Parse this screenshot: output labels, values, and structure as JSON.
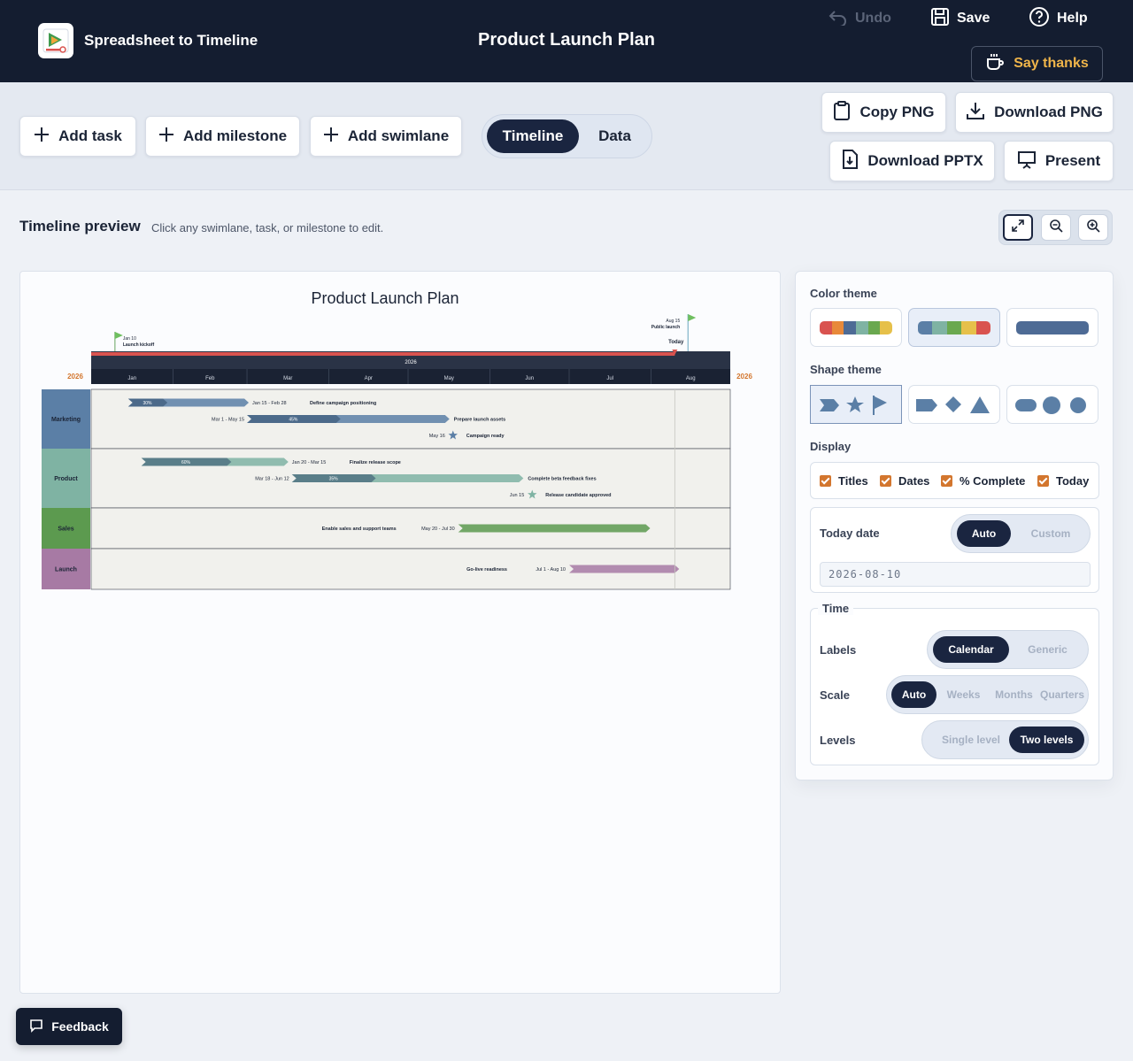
{
  "app": {
    "name": "Spreadsheet to Timeline",
    "document_title": "Product Launch Plan"
  },
  "header_actions": {
    "undo": "Undo",
    "save": "Save",
    "help": "Help",
    "say_thanks": "Say thanks"
  },
  "toolbar": {
    "add_task": "Add task",
    "add_milestone": "Add milestone",
    "add_swimlane": "Add swimlane",
    "view_tabs": [
      {
        "label": "Timeline",
        "active": true
      },
      {
        "label": "Data",
        "active": false
      }
    ],
    "copy_png": "Copy PNG",
    "download_png": "Download PNG",
    "download_pptx": "Download PPTX",
    "present": "Present"
  },
  "preview": {
    "title": "Timeline preview",
    "hint": "Click any swimlane, task, or milestone to edit.",
    "zoom_buttons": [
      "expand-icon",
      "zoom-out-icon",
      "zoom-in-icon"
    ]
  },
  "timeline": {
    "title": "Product Launch Plan",
    "year_left": "2026",
    "year_right": "2026",
    "year_band": "2026",
    "months": [
      "Jan",
      "Feb",
      "Mar",
      "Apr",
      "May",
      "Jun",
      "Jul",
      "Aug"
    ],
    "today_label": "Today",
    "top_milestones": [
      {
        "date": "Jan 10",
        "label": "Launch kickoff"
      },
      {
        "date": "Aug 15",
        "label": "Public launch"
      }
    ],
    "swimlanes": [
      {
        "name": "Marketing",
        "color": "#5b7fa6",
        "items": [
          {
            "type": "task",
            "title": "Define campaign positioning",
            "dates": "Jan 15 - Feb 28",
            "start": "Jan 15",
            "end": "Feb 28",
            "percent": "30%",
            "complete": 0.3,
            "color": "#5b7fa6"
          },
          {
            "type": "task",
            "title": "Prepare launch assets",
            "dates": "Mar 1 - May 15",
            "start": "Mar 1",
            "end": "May 15",
            "percent": "45%",
            "complete": 0.45,
            "color": "#5b7fa6"
          },
          {
            "type": "milestone",
            "title": "Campaign ready",
            "dates": "May 16",
            "date": "May 16",
            "color": "#5b7fa6"
          }
        ]
      },
      {
        "name": "Product",
        "color": "#7fb3a3",
        "items": [
          {
            "type": "task",
            "title": "Finalize release scope",
            "dates": "Jan 20 - Mar 15",
            "start": "Jan 20",
            "end": "Mar 15",
            "percent": "60%",
            "complete": 0.6,
            "color": "#7fb3a3"
          },
          {
            "type": "task",
            "title": "Complete beta feedback fixes",
            "dates": "Mar 18 - Jun 12",
            "start": "Mar 18",
            "end": "Jun 12",
            "percent": "35%",
            "complete": 0.35,
            "color": "#7fb3a3"
          },
          {
            "type": "milestone",
            "title": "Release candidate approved",
            "dates": "Jun 15",
            "date": "Jun 15",
            "color": "#7fb3a3"
          }
        ]
      },
      {
        "name": "Sales",
        "color": "#5c9a4f",
        "items": [
          {
            "type": "task",
            "title": "Enable sales and support teams",
            "dates": "May 20 - Jul 30",
            "start": "May 20",
            "end": "Jul 30",
            "color": "#5c9a4f"
          }
        ]
      },
      {
        "name": "Launch",
        "color": "#a77aa4",
        "items": [
          {
            "type": "task",
            "title": "Go-live readiness",
            "dates": "Jul 1 - Aug 10",
            "start": "Jul 1",
            "end": "Aug 10",
            "color": "#a77aa4"
          }
        ]
      }
    ]
  },
  "settings": {
    "color_theme_label": "Color theme",
    "color_themes": [
      {
        "colors": [
          "#d9534f",
          "#e8893a",
          "#4e6b95",
          "#7fb3a3",
          "#6aa84f",
          "#e6c04a"
        ],
        "selected": false
      },
      {
        "colors": [
          "#5b7fa6",
          "#7fb3a3",
          "#6aa84f",
          "#e6c04a",
          "#d9534f"
        ],
        "selected": true
      },
      {
        "colors": [
          "#4e6b95"
        ],
        "selected": false
      }
    ],
    "shape_theme_label": "Shape theme",
    "display_label": "Display",
    "display_options": [
      {
        "label": "Titles",
        "checked": true
      },
      {
        "label": "Dates",
        "checked": true
      },
      {
        "label": "% Complete",
        "checked": true
      },
      {
        "label": "Today",
        "checked": true
      }
    ],
    "today_date_label": "Today date",
    "today_modes": [
      {
        "label": "Auto",
        "active": true
      },
      {
        "label": "Custom",
        "active": false
      }
    ],
    "today_value": "2026-08-10",
    "time_label": "Time",
    "labels_label": "Labels",
    "labels_modes": [
      {
        "label": "Calendar",
        "active": true
      },
      {
        "label": "Generic",
        "active": false
      }
    ],
    "scale_label": "Scale",
    "scale_modes": [
      {
        "label": "Auto",
        "active": true
      },
      {
        "label": "Weeks",
        "active": false
      },
      {
        "label": "Months",
        "active": false
      },
      {
        "label": "Quarters",
        "active": false
      }
    ],
    "levels_label": "Levels",
    "levels_modes": [
      {
        "label": "Single level",
        "active": false
      },
      {
        "label": "Two levels",
        "active": true
      }
    ]
  },
  "feedback_label": "Feedback",
  "colors": {
    "header_bg": "#141d30",
    "accent_orange": "#d3762e",
    "today_red": "#d9534f",
    "thanks_gold": "#f0b54a"
  }
}
